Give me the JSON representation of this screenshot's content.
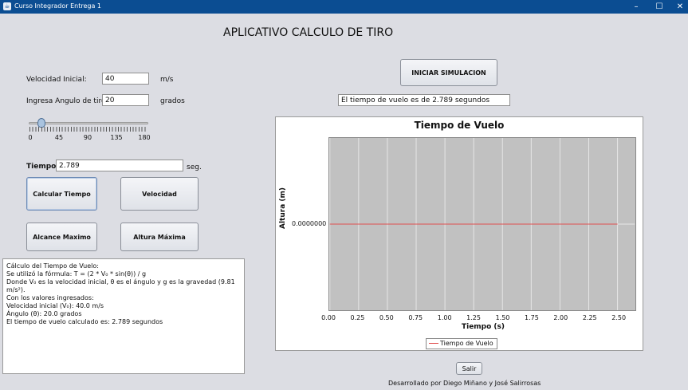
{
  "window": {
    "title": "Curso Integrador Entrega 1",
    "controls": [
      "–",
      "☐",
      "✕"
    ]
  },
  "heading": "APLICATIVO CALCULO DE TIRO",
  "form": {
    "velocity_label": "Velocidad Inicial:",
    "velocity_value": "40",
    "velocity_unit": "m/s",
    "angle_label": "Ingresa Angulo de tiro:",
    "angle_value": "20",
    "angle_unit": "grados",
    "slider_ticks": [
      "0",
      "45",
      "90",
      "135",
      "180"
    ],
    "slider_value": 20,
    "slider_min": 0,
    "slider_max": 180,
    "time_label": "Tiempo:",
    "time_value": "2.789",
    "time_unit": "seg."
  },
  "buttons": {
    "calc_time": "Calcular Tiempo",
    "velocity": "Velocidad",
    "max_range": "Alcance Maximo",
    "max_height": "Altura Máxima",
    "start_sim": "INICIAR SIMULACION",
    "exit": "Salir"
  },
  "result_text": "El tiempo de vuelo es de 2.789 segundos",
  "explanation": [
    "Cálculo del Tiempo de Vuelo:",
    "Se utilizó la fórmula: T = (2 * V₀ * sin(θ)) / g",
    "Donde V₀ es la velocidad inicial, θ es el ángulo y g es la gravedad (9.81 m/s²).",
    "Con los valores ingresados:",
    "Velocidad inicial (V₀): 40.0 m/s",
    "Ángulo (θ): 20.0 grados",
    "El tiempo de vuelo calculado es: 2.789 segundos"
  ],
  "chart_data": {
    "type": "line",
    "title": "Tiempo de Vuelo",
    "xlabel": "Tiempo (s)",
    "ylabel": "Altura (m)",
    "xlim": [
      0,
      2.65
    ],
    "x_ticks": [
      "0.00",
      "0.25",
      "0.50",
      "0.75",
      "1.00",
      "1.25",
      "1.50",
      "1.75",
      "2.00",
      "2.25",
      "2.50"
    ],
    "y_ticks": [
      "0.0000000"
    ],
    "grid": true,
    "legend": "bottom-center",
    "series": [
      {
        "name": "Tiempo de Vuelo",
        "color": "#e05050",
        "x": [
          0,
          2.5
        ],
        "y": [
          0,
          0
        ]
      }
    ]
  },
  "footer": "Desarrollado por Diego Miñano y José Salirrosas"
}
